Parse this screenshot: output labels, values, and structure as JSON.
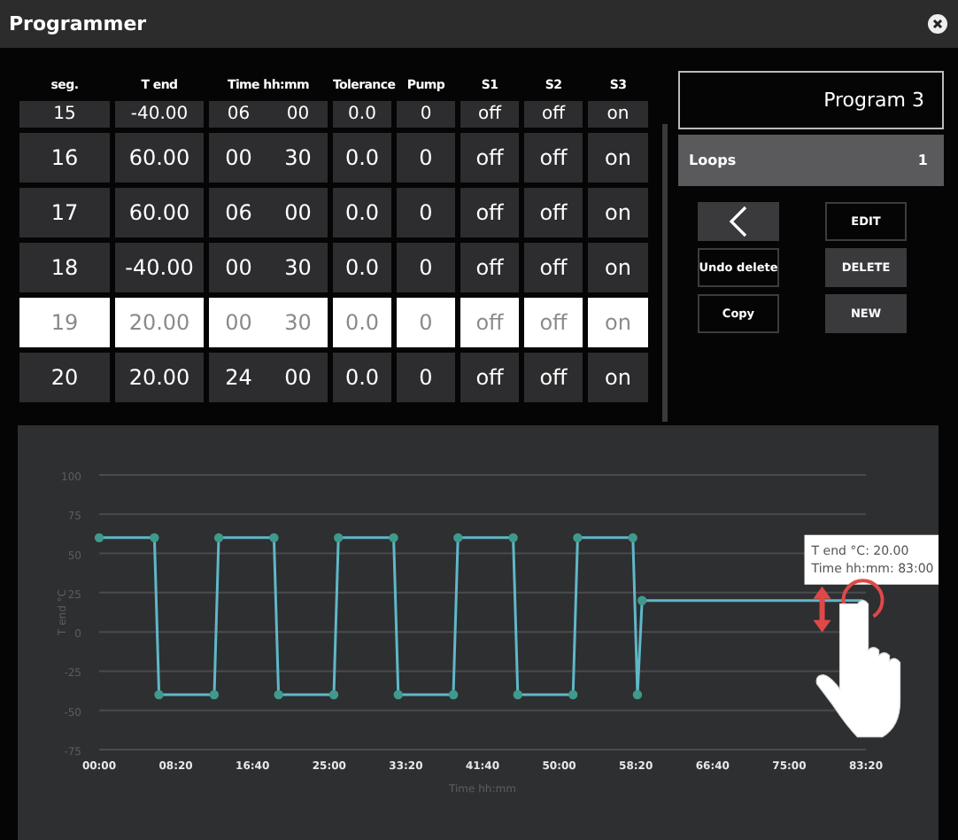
{
  "window": {
    "title": "Programmer"
  },
  "table": {
    "columns": [
      "seg.",
      "T end",
      "Time hh:mm",
      "Tolerance",
      "Pump",
      "S1",
      "S2",
      "S3"
    ],
    "rows": [
      {
        "seg": "15",
        "t_end": "-40.00",
        "hours": "06",
        "minutes": "00",
        "tolerance": "0.0",
        "pump": "0",
        "s1": "off",
        "s2": "off",
        "s3": "on",
        "selected": false
      },
      {
        "seg": "16",
        "t_end": "60.00",
        "hours": "00",
        "minutes": "30",
        "tolerance": "0.0",
        "pump": "0",
        "s1": "off",
        "s2": "off",
        "s3": "on",
        "selected": false
      },
      {
        "seg": "17",
        "t_end": "60.00",
        "hours": "06",
        "minutes": "00",
        "tolerance": "0.0",
        "pump": "0",
        "s1": "off",
        "s2": "off",
        "s3": "on",
        "selected": false
      },
      {
        "seg": "18",
        "t_end": "-40.00",
        "hours": "00",
        "minutes": "30",
        "tolerance": "0.0",
        "pump": "0",
        "s1": "off",
        "s2": "off",
        "s3": "on",
        "selected": false
      },
      {
        "seg": "19",
        "t_end": "20.00",
        "hours": "00",
        "minutes": "30",
        "tolerance": "0.0",
        "pump": "0",
        "s1": "off",
        "s2": "off",
        "s3": "on",
        "selected": true
      },
      {
        "seg": "20",
        "t_end": "20.00",
        "hours": "24",
        "minutes": "00",
        "tolerance": "0.0",
        "pump": "0",
        "s1": "off",
        "s2": "off",
        "s3": "on",
        "selected": false
      }
    ]
  },
  "program": {
    "name": "Program 3",
    "loops_label": "Loops",
    "loops_value": "1"
  },
  "buttons": [
    {
      "kind": "icon"
    },
    {
      "kind": "outlined",
      "label": "EDIT"
    },
    {
      "kind": "outlined",
      "label": "Undo delete"
    },
    {
      "kind": "filled",
      "label": "DELETE"
    },
    {
      "kind": "outlined",
      "label": "Copy"
    },
    {
      "kind": "filled",
      "label": "NEW"
    }
  ],
  "chart": {
    "chart_data": {
      "type": "line",
      "xlabel": "Time hh:mm",
      "ylabel": "T end °C",
      "x": [
        0,
        360,
        390,
        750,
        780,
        1140,
        1170,
        1530,
        1560,
        1920,
        1950,
        2310,
        2340,
        2700,
        2730,
        3090,
        3120,
        3480,
        3510,
        3540,
        4980
      ],
      "grid": true,
      "series": [
        {
          "color": "#5fb8c8",
          "marker": "circle",
          "values": [
            60,
            60,
            -40,
            -40,
            60,
            60,
            -40,
            -40,
            60,
            60,
            -40,
            -40,
            60,
            60,
            -40,
            -40,
            60,
            60,
            -40,
            20,
            20
          ]
        }
      ],
      "xlim": [
        0,
        5000
      ],
      "ylim": [
        -75,
        100
      ],
      "xticks": [
        {
          "value": 0,
          "label": "00:00"
        },
        {
          "value": 500,
          "label": "08:20"
        },
        {
          "value": 1000,
          "label": "16:40"
        },
        {
          "value": 1500,
          "label": "25:00"
        },
        {
          "value": 2000,
          "label": "33:20"
        },
        {
          "value": 2500,
          "label": "41:40"
        },
        {
          "value": 3000,
          "label": "50:00"
        },
        {
          "value": 3500,
          "label": "58:20"
        },
        {
          "value": 4000,
          "label": "66:40"
        },
        {
          "value": 4500,
          "label": "75:00"
        },
        {
          "value": 5000,
          "label": "83:20"
        }
      ],
      "yticks": [
        100,
        75,
        50,
        25,
        0,
        -25,
        -50,
        -75
      ],
      "annotations": [
        "T end °C: 20.00",
        "Time hh:mm: 83:00"
      ]
    }
  }
}
